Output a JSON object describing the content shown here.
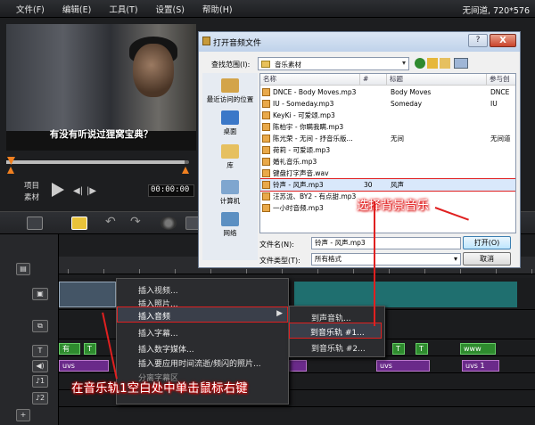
{
  "menubar": {
    "items": [
      "文件(F)",
      "编辑(E)",
      "工具(T)",
      "设置(S)",
      "帮助(H)"
    ],
    "app_title": "无间道, 720*576"
  },
  "preview": {
    "subtitle": "有没有听说过狸窝宝典？",
    "project_label": "项目",
    "clip_label": "素材",
    "timecode": "00:00:00"
  },
  "context_menu": {
    "items": [
      "插入视频...",
      "插入照片...",
      "插入音频",
      "插入字幕...",
      "插入数字媒体...",
      "插入要应用时间流逝/频闪的照片...",
      "分离字幕区"
    ],
    "submenu": [
      "到声音轨...",
      "到音乐轨 #1...",
      "到音乐轨 #2..."
    ],
    "highlighted": "插入音频"
  },
  "timeline": {
    "title_clips": [
      "有",
      "T",
      "T",
      "T",
      "www"
    ],
    "purple_clips": [
      "uvs",
      "uvs",
      "uvs",
      "uvs 1"
    ]
  },
  "dialog": {
    "title": "打开音频文件",
    "help": "?",
    "close": "X",
    "look_in_label": "查找范围(I):",
    "look_in_value": "音乐素材",
    "places": [
      "最近访问的位置",
      "桌面",
      "库",
      "计算机",
      "网络"
    ],
    "columns": [
      "名称",
      "#",
      "标题",
      "参与创"
    ],
    "files": [
      {
        "name": "DNCE - Body Moves.mp3",
        "num": "",
        "title": "Body Moves",
        "artist": "DNCE"
      },
      {
        "name": "IU - Someday.mp3",
        "num": "",
        "title": "Someday",
        "artist": "IU"
      },
      {
        "name": "KeyKi - 可爱颂.mp3",
        "num": "",
        "title": "",
        "artist": ""
      },
      {
        "name": "陈柏宇 - 你瞒我瞒.mp3",
        "num": "",
        "title": "",
        "artist": ""
      },
      {
        "name": "陈光荣 - 无间 - 抒音乐版...",
        "num": "",
        "title": "无间",
        "artist": "无间道"
      },
      {
        "name": "荷莉 - 可爱颂.mp3",
        "num": "",
        "title": "",
        "artist": ""
      },
      {
        "name": "婚礼音乐.mp3",
        "num": "",
        "title": "",
        "artist": ""
      },
      {
        "name": "键盘打字声音.wav",
        "num": "",
        "title": "",
        "artist": ""
      },
      {
        "name": "铃声 - 风声.mp3",
        "num": "30",
        "title": "风声",
        "artist": ""
      },
      {
        "name": "汪苏泷、BY2 - 有点甜.mp3",
        "num": "",
        "title": "",
        "artist": ""
      },
      {
        "name": "一小时音频.mp3",
        "num": "",
        "title": "",
        "artist": ""
      }
    ],
    "selected_index": 8,
    "filename_label": "文件名(N):",
    "filename_value": "铃声 - 风声.mp3",
    "filetype_label": "文件类型(T):",
    "filetype_value": "所有格式",
    "open_button": "打开(O)",
    "cancel_button": "取消"
  },
  "annotations": {
    "select_music": "选择背景音乐",
    "right_click": "在音乐轨1空白处中单击鼠标右键"
  },
  "colors": {
    "highlight_border": "#e02020",
    "annotation_text": "#ffffff",
    "dialog_bg": "#f0f0f0"
  }
}
